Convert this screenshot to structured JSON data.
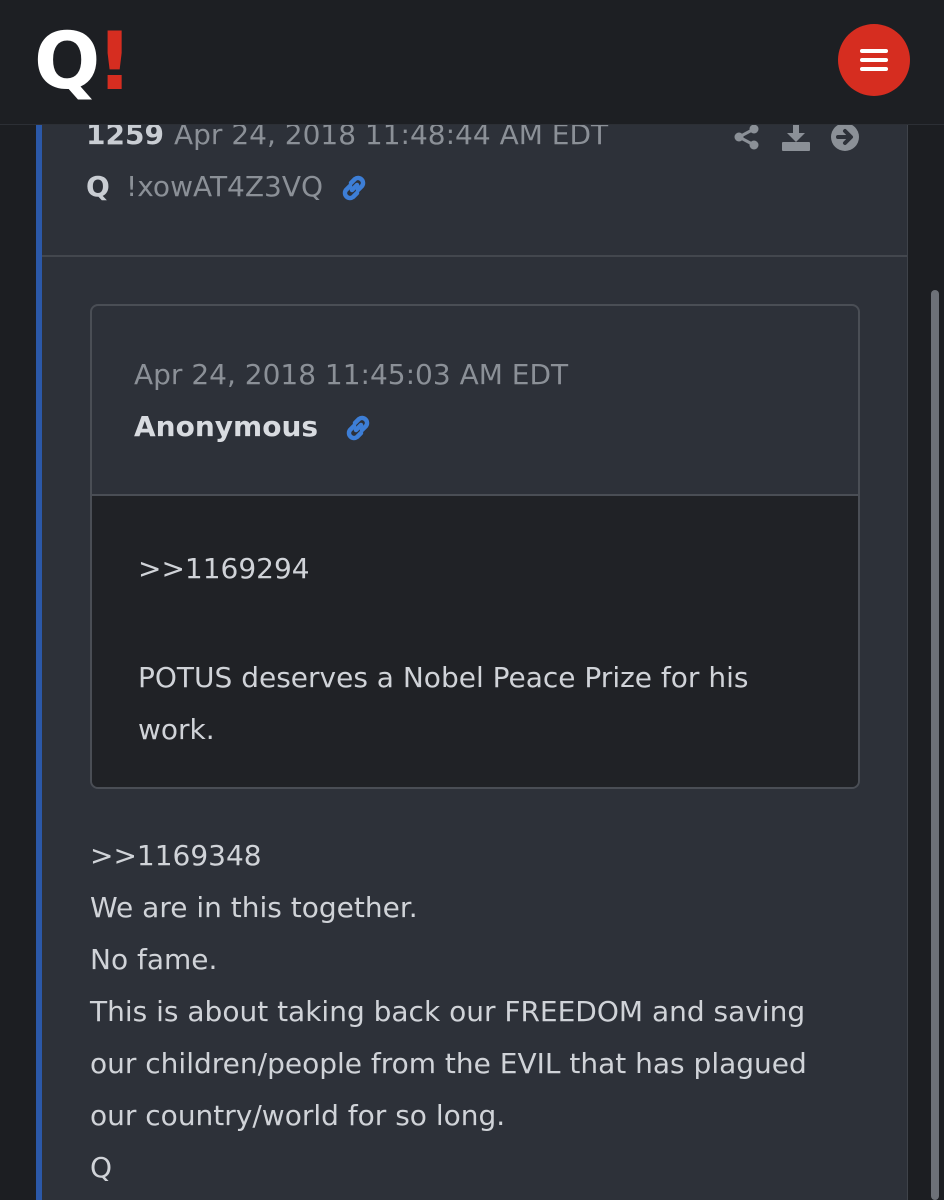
{
  "header": {
    "logo_letter": "Q",
    "logo_mark": "!",
    "menu_icon": "hamburger-icon",
    "accent_color": "#d62d20"
  },
  "post": {
    "number": "1259",
    "timestamp": "Apr 24, 2018 11:48:44 AM EDT",
    "author": "Q",
    "tripcode": "!xowAT4Z3VQ",
    "icons": [
      "share-icon",
      "download-icon",
      "arrow-right-icon",
      "link-icon"
    ],
    "quoted": {
      "timestamp": "Apr 24, 2018 11:45:03 AM EDT",
      "author": "Anonymous",
      "reference": ">>1169294",
      "text": "POTUS deserves a Nobel Peace Prize for his work."
    },
    "body": [
      ">>1169348",
      "We are in this together.",
      "No fame.",
      "This is about taking back our FREEDOM and saving",
      "our children/people from the EVIL that has plagued",
      "our country/world for so long.",
      "Q"
    ]
  }
}
